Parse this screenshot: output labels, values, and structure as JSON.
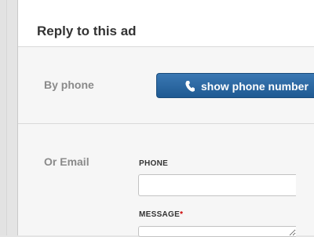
{
  "header": {
    "title": "Reply to this ad"
  },
  "phone_section": {
    "label": "By phone",
    "button_label": "show phone number",
    "button_icon": "phone-icon"
  },
  "email_section": {
    "label": "Or Email",
    "phone_field": {
      "label": "PHONE",
      "value": ""
    },
    "message_field": {
      "label": "MESSAGE",
      "required_marker": "*",
      "value": ""
    }
  },
  "colors": {
    "button_blue": "#2a67a2",
    "required_red": "#cc0000",
    "label_gray": "#8a8a8a"
  }
}
